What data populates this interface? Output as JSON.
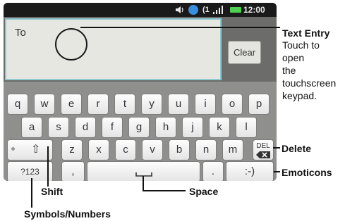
{
  "status_bar": {
    "time": "12:00",
    "alarm_glyph": "(1",
    "volume_icon": "volume-icon",
    "globe_icon": "globe-icon",
    "signal_icon": "signal-icon",
    "battery_icon": "battery-icon"
  },
  "compose": {
    "to_label": "To",
    "clear_label": "Clear"
  },
  "keyboard": {
    "row1": [
      "q",
      "w",
      "e",
      "r",
      "t",
      "y",
      "u",
      "i",
      "o",
      "p"
    ],
    "row2": [
      "a",
      "s",
      "d",
      "f",
      "g",
      "h",
      "j",
      "k",
      "l"
    ],
    "row3": [
      "z",
      "x",
      "c",
      "v",
      "b",
      "n",
      "m"
    ],
    "shift_glyph": "⇧",
    "delete_label": "DEL",
    "symbols_label": "?123",
    "comma": ",",
    "period": ".",
    "emoticon": ":-)"
  },
  "callouts": {
    "text_entry_title": "Text Entry",
    "text_entry_lines": [
      "Touch to",
      "open",
      "the",
      "touchscreen",
      "keypad."
    ],
    "delete": "Delete",
    "emoticons": "Emoticons",
    "shift": "Shift",
    "space": "Space",
    "symbols": "Symbols/Numbers"
  },
  "colors": {
    "field_border": "#8ec9d3",
    "battery": "#4fd04f",
    "globe": "#3a8ee0"
  }
}
